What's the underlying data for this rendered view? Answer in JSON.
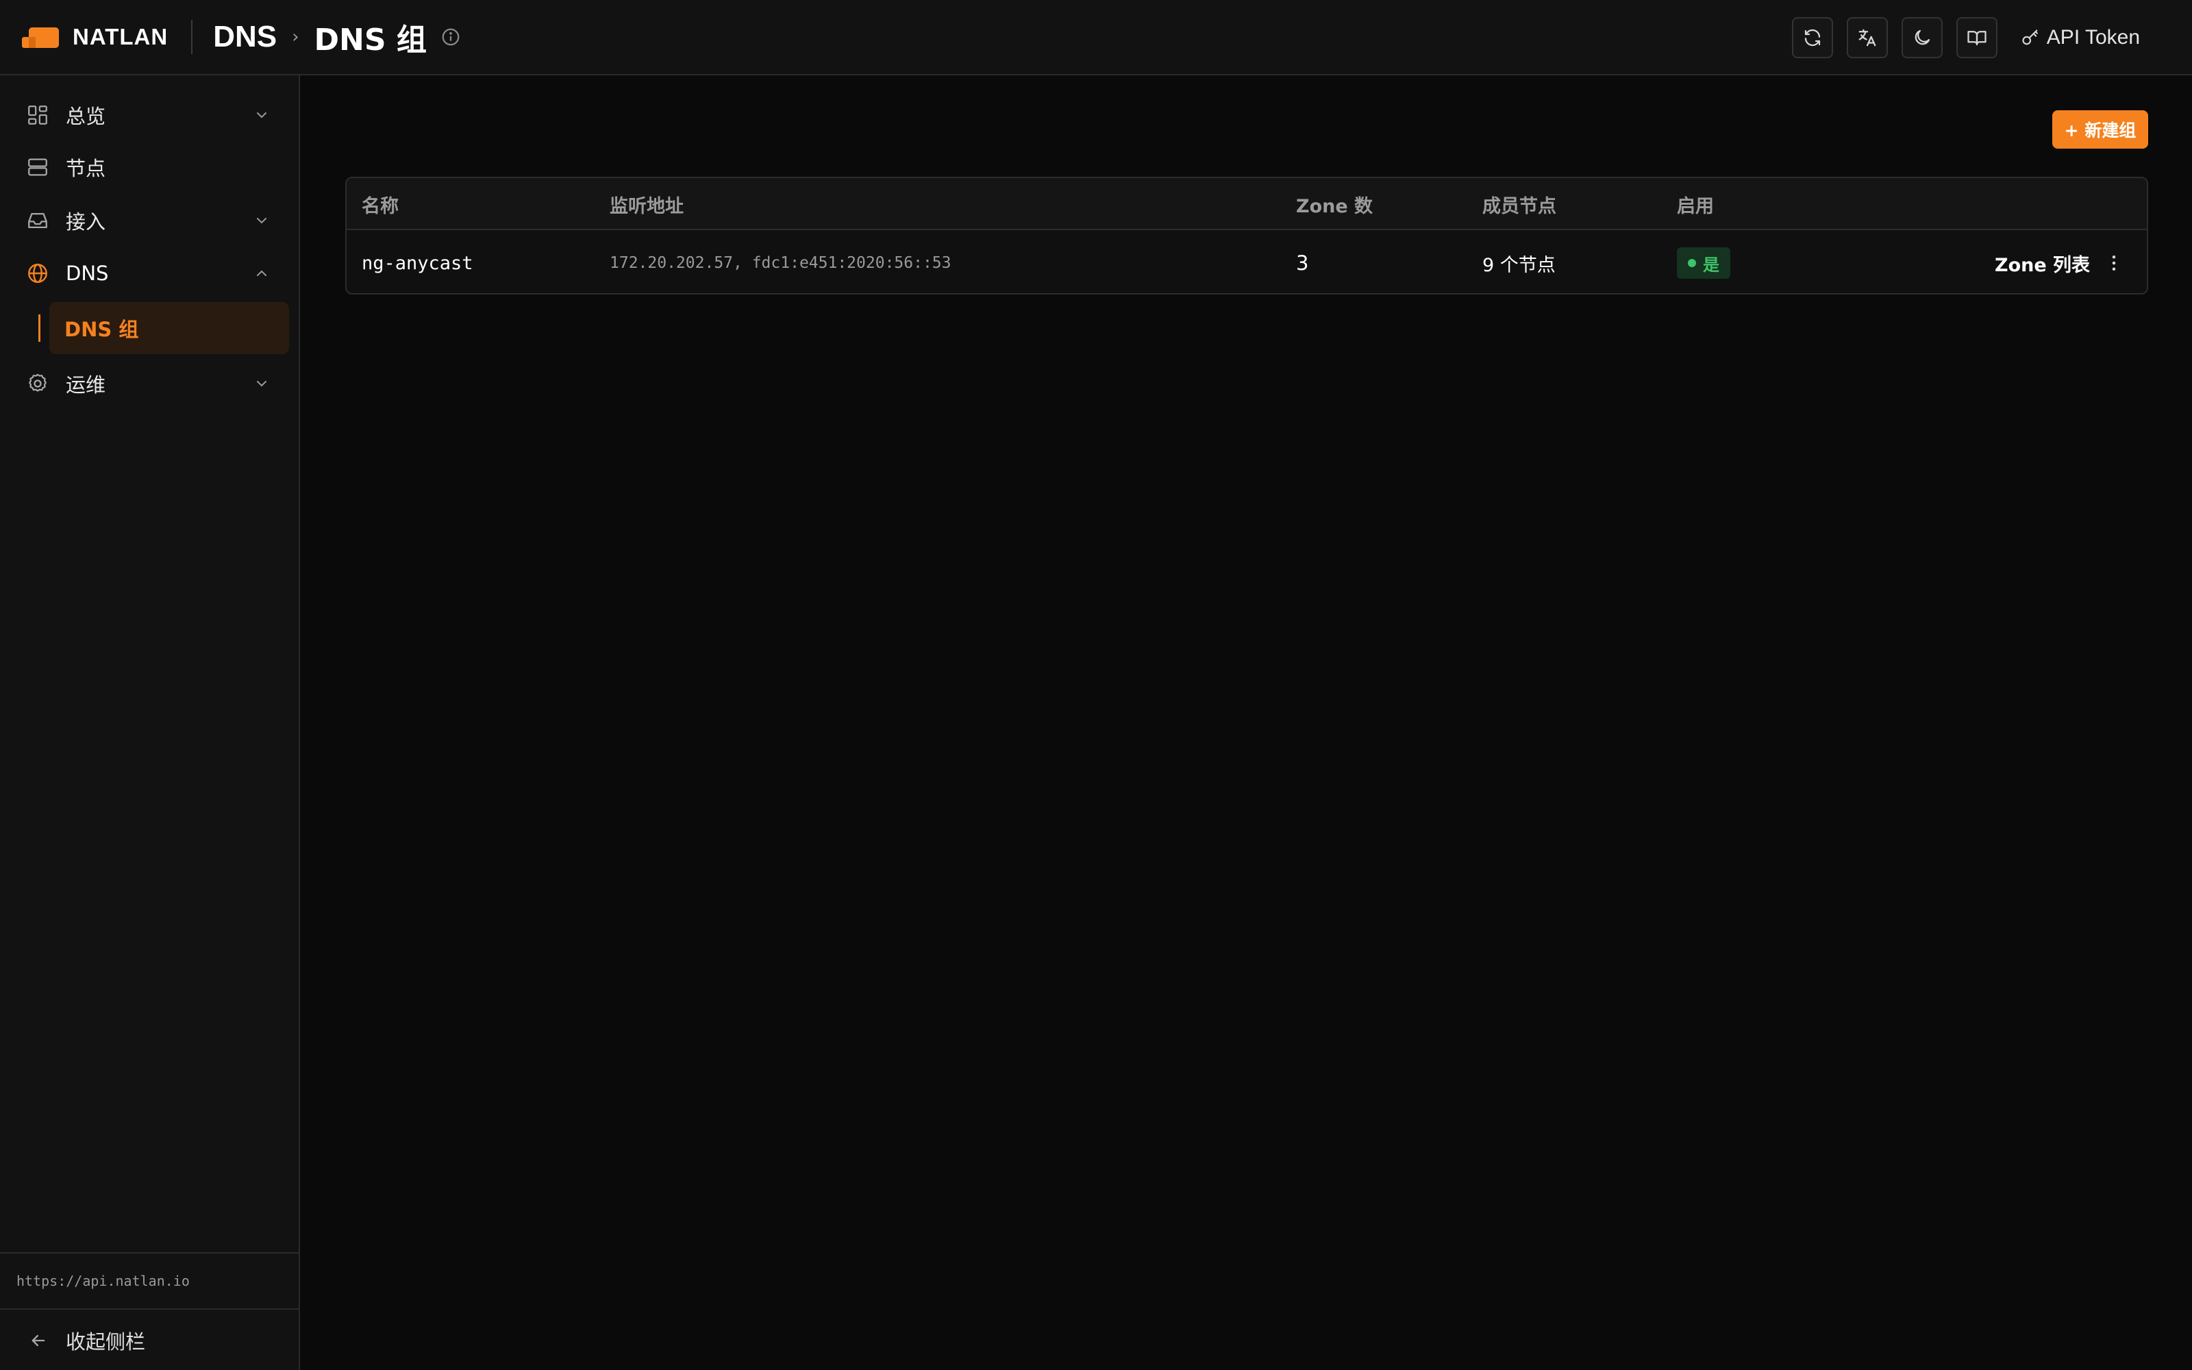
{
  "header": {
    "brand": "NATLAN",
    "breadcrumb_root": "DNS",
    "breadcrumb_sep": "›",
    "breadcrumb_current": "DNS 组",
    "api_token_label": "API Token",
    "brand_color": "#f5821f",
    "icons": [
      "refresh-icon",
      "translate-icon",
      "moon-icon",
      "book-icon",
      "key-icon"
    ]
  },
  "sidebar": {
    "items": [
      {
        "label": "总览",
        "icon": "dashboard-icon",
        "expandable": true
      },
      {
        "label": "节点",
        "icon": "server-icon",
        "expandable": false
      },
      {
        "label": "接入",
        "icon": "inbox-icon",
        "expandable": true
      },
      {
        "label": "DNS",
        "icon": "globe-icon",
        "expandable": true,
        "expanded": true
      },
      {
        "label": "运维",
        "icon": "gear-icon",
        "expandable": true
      }
    ],
    "subitems": [
      {
        "label": "DNS 组",
        "active": true
      }
    ],
    "api_url": "https://api.natlan.io",
    "collapse_label": "收起侧栏"
  },
  "main": {
    "new_group_label": "+ 新建组",
    "table": {
      "columns": [
        "名称",
        "监听地址",
        "Zone 数",
        "成员节点",
        "启用"
      ],
      "rows": [
        {
          "name": "ng-anycast",
          "listen": "172.20.202.57, fdc1:e451:2020:56::53",
          "zones": "3",
          "members": "9 个节点",
          "enabled": "是",
          "action": "Zone 列表"
        }
      ]
    }
  }
}
